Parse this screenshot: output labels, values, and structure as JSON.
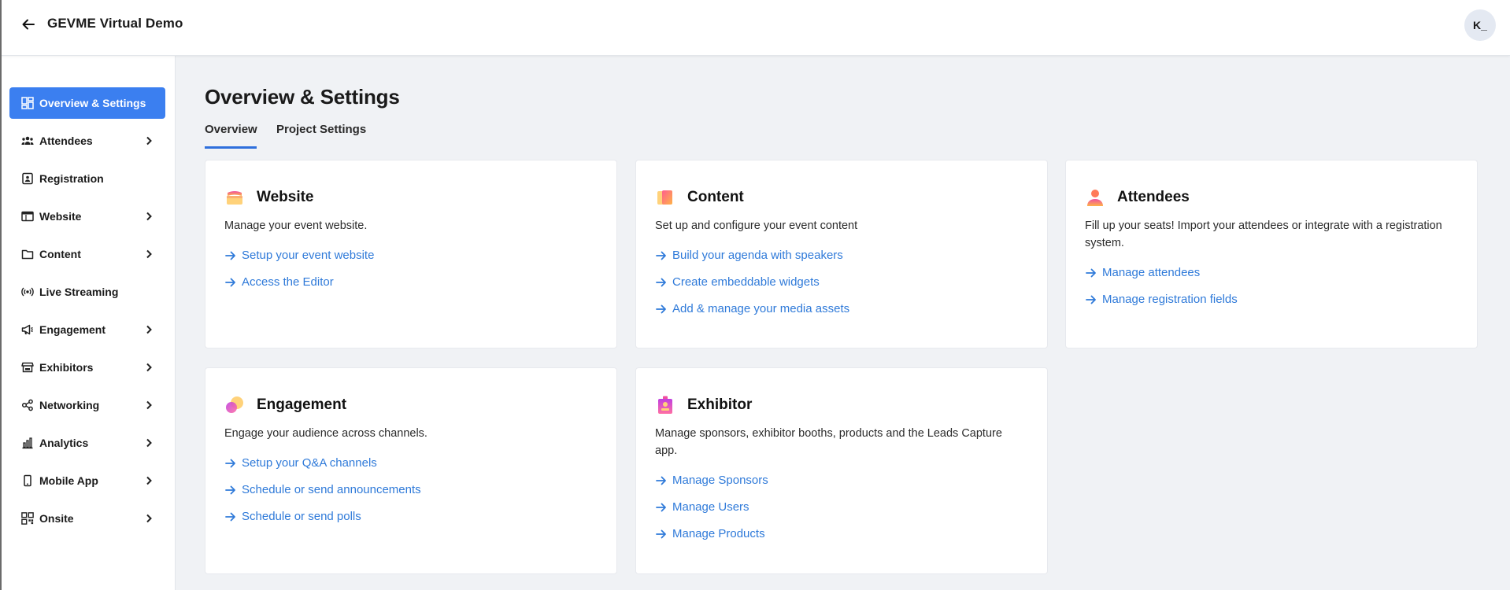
{
  "header": {
    "title": "GEVME Virtual Demo",
    "avatar_initials": "K_"
  },
  "sidebar": {
    "items": [
      {
        "label": "Overview & Settings",
        "icon": "dashboard-icon",
        "active": true,
        "has_chevron": false
      },
      {
        "label": "Attendees",
        "icon": "people-icon",
        "has_chevron": true
      },
      {
        "label": "Registration",
        "icon": "id-badge-icon",
        "has_chevron": false
      },
      {
        "label": "Website",
        "icon": "browser-icon",
        "has_chevron": true
      },
      {
        "label": "Content",
        "icon": "folder-icon",
        "has_chevron": true
      },
      {
        "label": "Live Streaming",
        "icon": "broadcast-icon",
        "has_chevron": false
      },
      {
        "label": "Engagement",
        "icon": "megaphone-icon",
        "has_chevron": true
      },
      {
        "label": "Exhibitors",
        "icon": "store-icon",
        "has_chevron": true
      },
      {
        "label": "Networking",
        "icon": "network-icon",
        "has_chevron": true
      },
      {
        "label": "Analytics",
        "icon": "bar-chart-icon",
        "has_chevron": true
      },
      {
        "label": "Mobile App",
        "icon": "mobile-icon",
        "has_chevron": true
      },
      {
        "label": "Onsite",
        "icon": "grid-icon",
        "has_chevron": true
      }
    ]
  },
  "main": {
    "title": "Overview & Settings",
    "tabs": [
      {
        "label": "Overview",
        "active": true
      },
      {
        "label": "Project Settings",
        "active": false
      }
    ],
    "cards": [
      {
        "title": "Website",
        "icon": "website-icon",
        "description": "Manage your event website.",
        "links": [
          "Setup your event website",
          "Access the Editor"
        ]
      },
      {
        "title": "Content",
        "icon": "content-icon",
        "description": "Set up and configure your event content",
        "links": [
          "Build your agenda with speakers",
          "Create embeddable widgets",
          "Add & manage your media assets"
        ]
      },
      {
        "title": "Attendees",
        "icon": "attendee-icon",
        "description": "Fill up your seats! Import your attendees or integrate with a registration system.",
        "links": [
          "Manage attendees",
          "Manage registration fields"
        ]
      },
      {
        "title": "Engagement",
        "icon": "engagement-icon",
        "description": "Engage your audience across channels.",
        "links": [
          "Setup your Q&A channels",
          "Schedule or send announcements",
          "Schedule or send polls"
        ]
      },
      {
        "title": "Exhibitor",
        "icon": "exhibitor-icon",
        "description": "Manage sponsors, exhibitor booths, products and the Leads Capture app.",
        "links": [
          "Manage Sponsors",
          "Manage Users",
          "Manage Products"
        ]
      }
    ]
  },
  "colors": {
    "accent": "#3b7ff0",
    "link": "#2f7ad9",
    "background": "#f0f2f5"
  }
}
